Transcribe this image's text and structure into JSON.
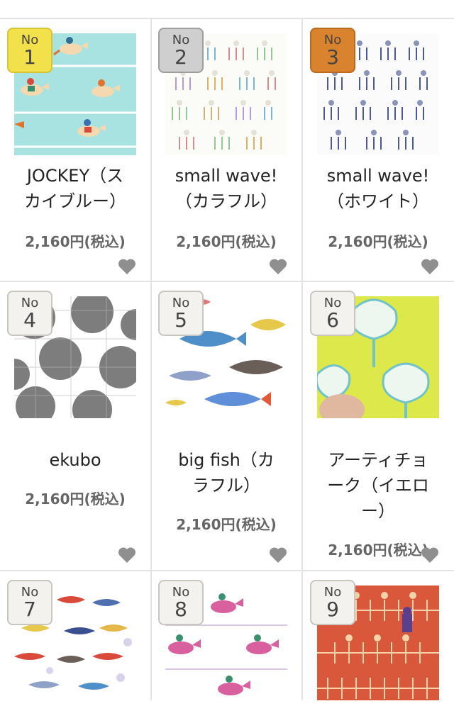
{
  "badge_label": "No",
  "products": [
    {
      "rank": "1",
      "title_line1": "JOCKEY（ス",
      "title_line2": "カイブルー）",
      "title_line3": "",
      "price": "2,160円(税込)",
      "icon": "heart-icon"
    },
    {
      "rank": "2",
      "title_line1": "small wave!",
      "title_line2": "（カラフル）",
      "title_line3": "",
      "price": "2,160円(税込)",
      "icon": "heart-icon"
    },
    {
      "rank": "3",
      "title_line1": "small wave!",
      "title_line2": "（ホワイト）",
      "title_line3": "",
      "price": "2,160円(税込)",
      "icon": "heart-icon"
    },
    {
      "rank": "4",
      "title_line1": "ekubo",
      "title_line2": "",
      "title_line3": "",
      "price": "2,160円(税込)",
      "icon": "heart-icon"
    },
    {
      "rank": "5",
      "title_line1": "big fish（カ",
      "title_line2": "ラフル）",
      "title_line3": "",
      "price": "2,160円(税込)",
      "icon": "heart-icon"
    },
    {
      "rank": "6",
      "title_line1": "アーティチョ",
      "title_line2": "ーク（イエロ",
      "title_line3": "ー）",
      "price": "2,160円(税込)",
      "icon": "heart-icon"
    },
    {
      "rank": "7"
    },
    {
      "rank": "8"
    },
    {
      "rank": "9"
    }
  ],
  "colors": {
    "gold": "#f3e14b",
    "silver": "#cfcfcf",
    "bronze": "#d9832e",
    "plain": "#f4f2ee",
    "heart": "#8f8f8f",
    "separator": "#e3e3e3"
  }
}
